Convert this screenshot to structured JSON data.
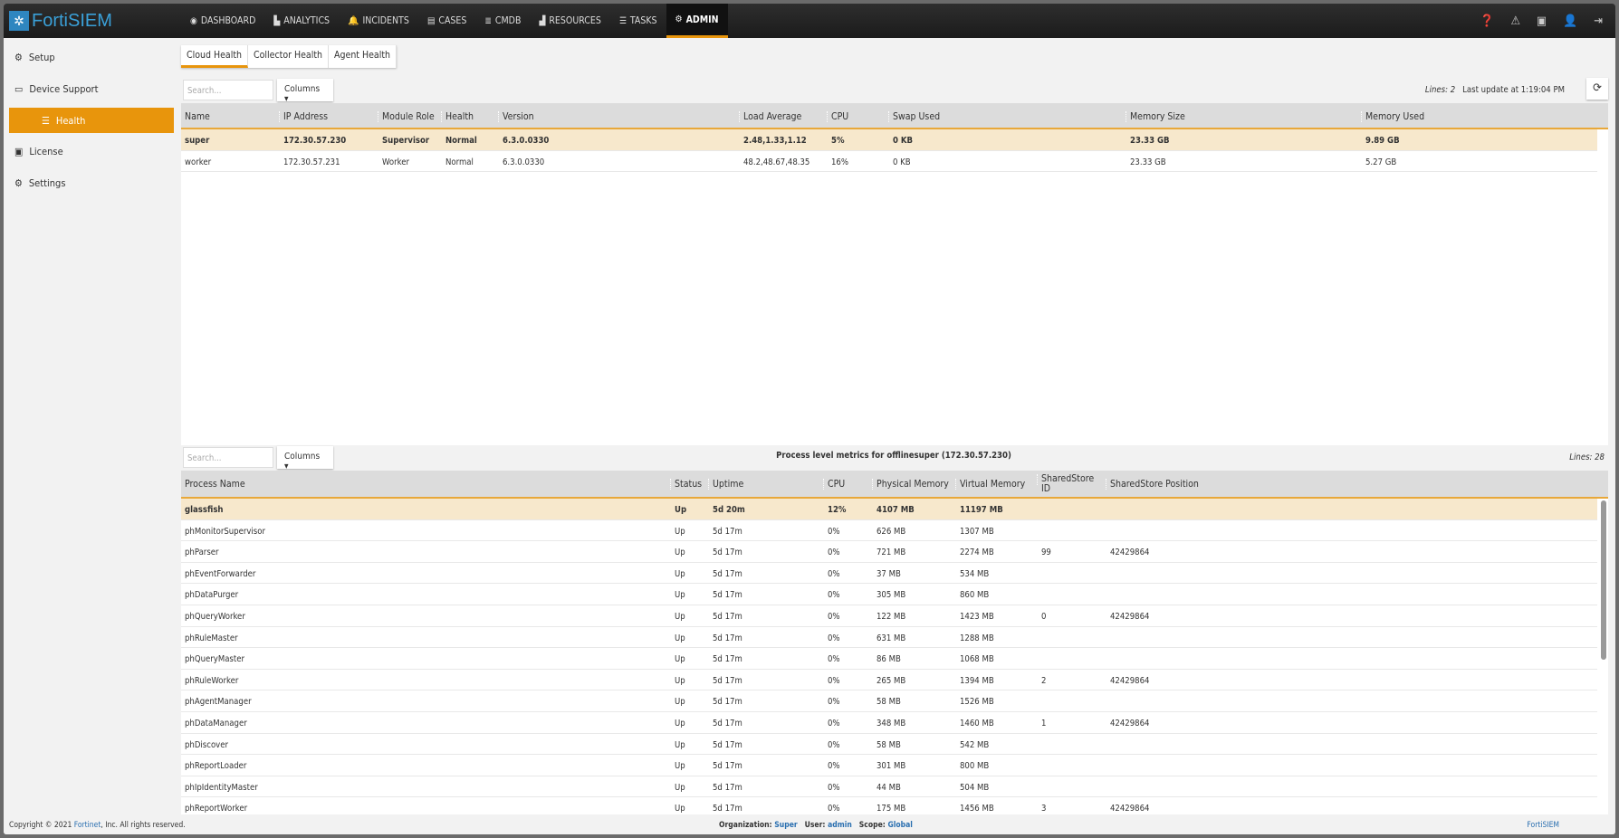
{
  "app": {
    "logo": "FortiSIEM"
  },
  "nav": [
    {
      "icon": "dashboard-icon",
      "glyph": "◉",
      "label": "DASHBOARD"
    },
    {
      "icon": "analytics-icon",
      "glyph": "▙",
      "label": "ANALYTICS"
    },
    {
      "icon": "bell-icon",
      "glyph": "🔔",
      "label": "INCIDENTS"
    },
    {
      "icon": "archive-icon",
      "glyph": "▤",
      "label": "CASES"
    },
    {
      "icon": "database-icon",
      "glyph": "≣",
      "label": "CMDB"
    },
    {
      "icon": "chart-icon",
      "glyph": "▟",
      "label": "RESOURCES"
    },
    {
      "icon": "list-icon",
      "glyph": "☰",
      "label": "TASKS"
    },
    {
      "icon": "cogs-icon",
      "glyph": "⚙",
      "label": "ADMIN",
      "active": true
    }
  ],
  "sidebar": [
    {
      "icon": "gear-icon",
      "glyph": "⚙",
      "label": "Setup"
    },
    {
      "icon": "hdd-icon",
      "glyph": "▭",
      "label": "Device Support"
    },
    {
      "icon": "list-icon",
      "glyph": "☰",
      "label": "Health",
      "active": true
    },
    {
      "icon": "id-card-icon",
      "glyph": "▣",
      "label": "License"
    },
    {
      "icon": "cogs-icon",
      "glyph": "⚙",
      "label": "Settings"
    }
  ],
  "tabs": [
    "Cloud Health",
    "Collector Health",
    "Agent Health"
  ],
  "top_table": {
    "search_placeholder": "Search...",
    "columns_label": "Columns ▾",
    "lines_label": "Lines: 2",
    "last_update": "Last update at 1:19:04 PM",
    "headers": [
      "Name",
      "IP Address",
      "Module Role",
      "Health",
      "Version",
      "Load Average",
      "CPU",
      "Swap Used",
      "Memory Size",
      "Memory Used"
    ],
    "rows": [
      [
        "super",
        "172.30.57.230",
        "Supervisor",
        "Normal",
        "6.3.0.0330",
        "2.48,1.33,1.12",
        "5%",
        "0 KB",
        "23.33 GB",
        "9.89 GB"
      ],
      [
        "worker",
        "172.30.57.231",
        "Worker",
        "Normal",
        "6.3.0.0330",
        "48.2,48.67,48.35",
        "16%",
        "0 KB",
        "23.33 GB",
        "5.27 GB"
      ]
    ]
  },
  "process_table": {
    "search_placeholder": "Search...",
    "columns_label": "Columns ▾",
    "title": "Process level metrics for offlinesuper (172.30.57.230)",
    "lines_label": "Lines: 28",
    "headers": [
      "Process Name",
      "Status",
      "Uptime",
      "CPU",
      "Physical Memory",
      "Virtual Memory",
      "SharedStore ID",
      "SharedStore Position"
    ],
    "rows": [
      [
        "glassfish",
        "Up",
        "5d 20m",
        "12%",
        "4107 MB",
        "11197 MB",
        "",
        ""
      ],
      [
        "phMonitorSupervisor",
        "Up",
        "5d 17m",
        "0%",
        "626 MB",
        "1307 MB",
        "",
        ""
      ],
      [
        "phParser",
        "Up",
        "5d 17m",
        "0%",
        "721 MB",
        "2274 MB",
        "99",
        "42429864"
      ],
      [
        "phEventForwarder",
        "Up",
        "5d 17m",
        "0%",
        "37 MB",
        "534 MB",
        "",
        ""
      ],
      [
        "phDataPurger",
        "Up",
        "5d 17m",
        "0%",
        "305 MB",
        "860 MB",
        "",
        ""
      ],
      [
        "phQueryWorker",
        "Up",
        "5d 17m",
        "0%",
        "122 MB",
        "1423 MB",
        "0",
        "42429864"
      ],
      [
        "phRuleMaster",
        "Up",
        "5d 17m",
        "0%",
        "631 MB",
        "1288 MB",
        "",
        ""
      ],
      [
        "phQueryMaster",
        "Up",
        "5d 17m",
        "0%",
        "86 MB",
        "1068 MB",
        "",
        ""
      ],
      [
        "phRuleWorker",
        "Up",
        "5d 17m",
        "0%",
        "265 MB",
        "1394 MB",
        "2",
        "42429864"
      ],
      [
        "phAgentManager",
        "Up",
        "5d 17m",
        "0%",
        "58 MB",
        "1526 MB",
        "",
        ""
      ],
      [
        "phDataManager",
        "Up",
        "5d 17m",
        "0%",
        "348 MB",
        "1460 MB",
        "1",
        "42429864"
      ],
      [
        "phDiscover",
        "Up",
        "5d 17m",
        "0%",
        "58 MB",
        "542 MB",
        "",
        ""
      ],
      [
        "phReportLoader",
        "Up",
        "5d 17m",
        "0%",
        "301 MB",
        "800 MB",
        "",
        ""
      ],
      [
        "phIpIdentityMaster",
        "Up",
        "5d 17m",
        "0%",
        "44 MB",
        "504 MB",
        "",
        ""
      ],
      [
        "phReportWorker",
        "Up",
        "5d 17m",
        "0%",
        "175 MB",
        "1456 MB",
        "3",
        "42429864"
      ]
    ]
  },
  "footer": {
    "copyright_prefix": "Copyright © 2021 ",
    "fortinet": "Fortinet",
    "copyright_suffix": ", Inc. All rights reserved.",
    "org_label": "Organization:",
    "org": "Super",
    "user_label": "User:",
    "user": "admin",
    "scope_label": "Scope:",
    "scope": "Global",
    "brand": "FortiSIEM"
  }
}
